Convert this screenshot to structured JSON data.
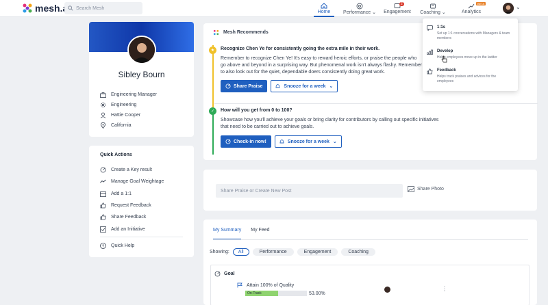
{
  "header": {
    "logo_text": "mesh.ai",
    "search_placeholder": "Search Mesh",
    "nav": {
      "home": "Home",
      "performance": "Performance",
      "engagement": "Engagement",
      "engagement_badge": "2",
      "coaching": "Coaching",
      "analytics": "Analytics",
      "analytics_badge": "BETA"
    }
  },
  "profile": {
    "name": "Sibley Bourn",
    "role": "Engineering Manager",
    "department": "Engineering",
    "manager": "Hattie Cooper",
    "location": "California"
  },
  "quick_actions": {
    "title": "Quick Actions",
    "items": [
      "Create a Key result",
      "Manage Goal Weightage",
      "Add a 1:1",
      "Request Feedback",
      "Share Feedback",
      "Add an Initiative"
    ],
    "help": "Quick Help"
  },
  "recommends": {
    "title": "Mesh Recommends",
    "item1": {
      "title": "Recognize Chen Ye for consistently going the extra mile in their work.",
      "body": "Remember to recognize Chen Ye! It's easy to reward heroic efforts, or praise the people who go above and beyond in a surprising way. But phenomenal work isn't always flashy. Remember to also look out for the quiet, dependable doers consistently doing great work.",
      "primary": "Share Praise",
      "secondary": "Snooze for a week"
    },
    "item2": {
      "title": "How will you get from 0 to 100?",
      "body": "Showcase how you'll achieve your goals or bring clarity for contributors by calling out specific initiatives that need to be carried out to achieve goals.",
      "primary": "Check-in now!",
      "secondary": "Snooze for a week"
    }
  },
  "post": {
    "placeholder": "Share Praise or Create New Post",
    "photo": "Share Photo"
  },
  "summary": {
    "tabs": [
      "My Summary",
      "My Feed"
    ],
    "showing_label": "Showing:",
    "filters": [
      "All",
      "Performance",
      "Engagement",
      "Coaching"
    ],
    "goal_section": "Goal",
    "goal_title": "Attain 100% of Quality",
    "status": "On-Track",
    "progress": 0.53,
    "progress_text": "53.00%"
  },
  "coaching_menu": {
    "items": [
      {
        "title": "1:1s",
        "desc": "Set up 1:1 conversations with Managers & team members"
      },
      {
        "title": "Develop",
        "desc": "Helps employees move up in the ladder"
      },
      {
        "title": "Feedback",
        "desc": "Helps track praises and advices for the employees"
      }
    ]
  },
  "colors": {
    "accent": "#1f5fbf",
    "timeline_yellow": "#f0c12a",
    "timeline_green": "#2eab57"
  }
}
